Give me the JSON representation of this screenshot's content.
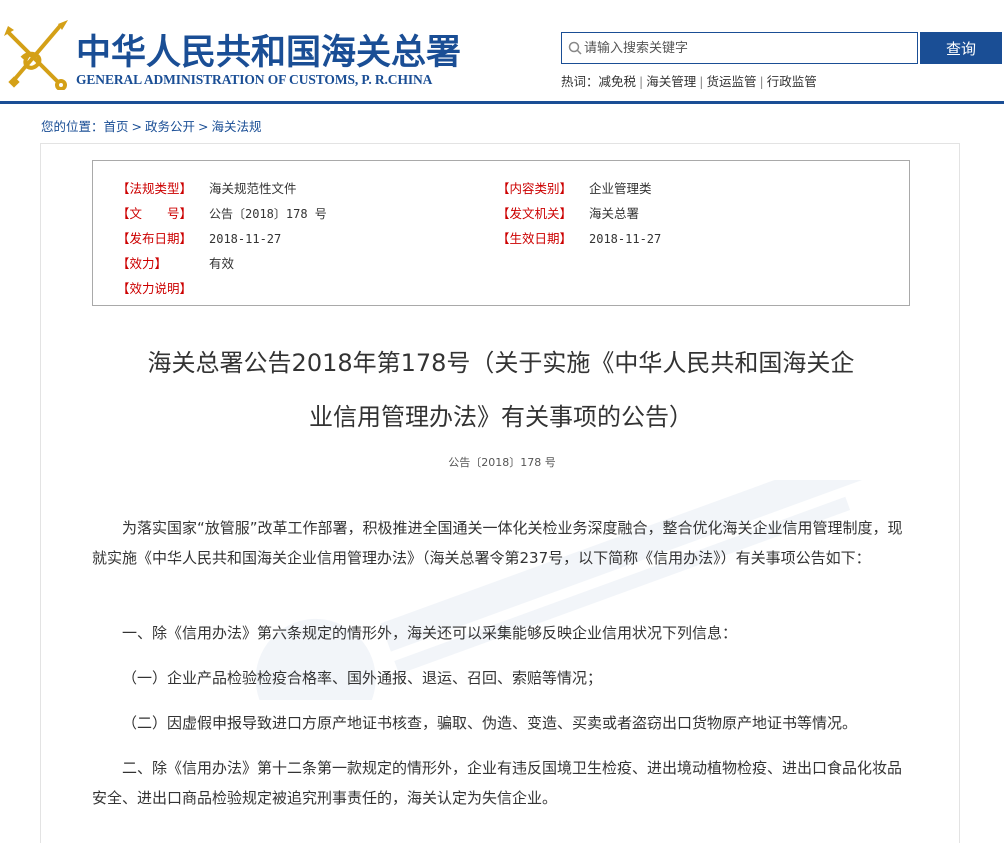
{
  "header": {
    "logo_cn": "中华人民共和国海关总署",
    "logo_en": "GENERAL ADMINISTRATION OF CUSTOMS, P. R.CHINA",
    "search": {
      "placeholder": "请输入搜索关键字",
      "button_label": "查询"
    },
    "hot": {
      "label": "热词：",
      "keywords": [
        "减免税",
        "海关管理",
        "货运监管",
        "行政监管"
      ],
      "separator": "|"
    }
  },
  "breadcrumb": {
    "prefix": "您的位置：",
    "items": [
      "首页",
      "政务公开",
      "海关法规"
    ],
    "separator": ">"
  },
  "meta": {
    "left": [
      {
        "key": "【法规类型】",
        "value": "海关规范性文件"
      },
      {
        "key": "【文　　号】",
        "value": "公告〔2018〕178 号"
      },
      {
        "key": "【发布日期】",
        "value": "2018-11-27"
      },
      {
        "key": "【效力】",
        "value": "有效"
      },
      {
        "key": "【效力说明】",
        "value": ""
      }
    ],
    "right": [
      {
        "key": "【内容类别】",
        "value": "企业管理类"
      },
      {
        "key": "【发文机关】",
        "value": "海关总署"
      },
      {
        "key": "【生效日期】",
        "value": "2018-11-27"
      }
    ]
  },
  "document": {
    "title_line1": "海关总署公告2018年第178号（关于实施《中华人民共和国海关企",
    "title_line2": "业信用管理办法》有关事项的公告）",
    "number": "公告〔2018〕178 号",
    "paragraphs": [
      "为落实国家“放管服”改革工作部署，积极推进全国通关一体化关检业务深度融合，整合优化海关企业信用管理制度，现就实施《中华人民共和国海关企业信用管理办法》（海关总署令第237号，以下简称《信用办法》）有关事项公告如下：",
      "一、除《信用办法》第六条规定的情形外，海关还可以采集能够反映企业信用状况下列信息：",
      "（一）企业产品检验检疫合格率、国外通报、退运、召回、索赔等情况；",
      "（二）因虚假申报导致进口方原产地证书核查，骗取、伪造、变造、买卖或者盗窃出口货物原产地证书等情况。",
      "二、除《信用办法》第十二条第一款规定的情形外，企业有违反国境卫生检疫、进出境动植物检疫、进出口食品化妆品安全、进出口商品检验规定被追究刑事责任的，海关认定为失信企业。"
    ]
  },
  "colors": {
    "brand_blue": "#1a4e95",
    "meta_key_red": "#cc0000",
    "emblem_gold": "#d4a017"
  }
}
